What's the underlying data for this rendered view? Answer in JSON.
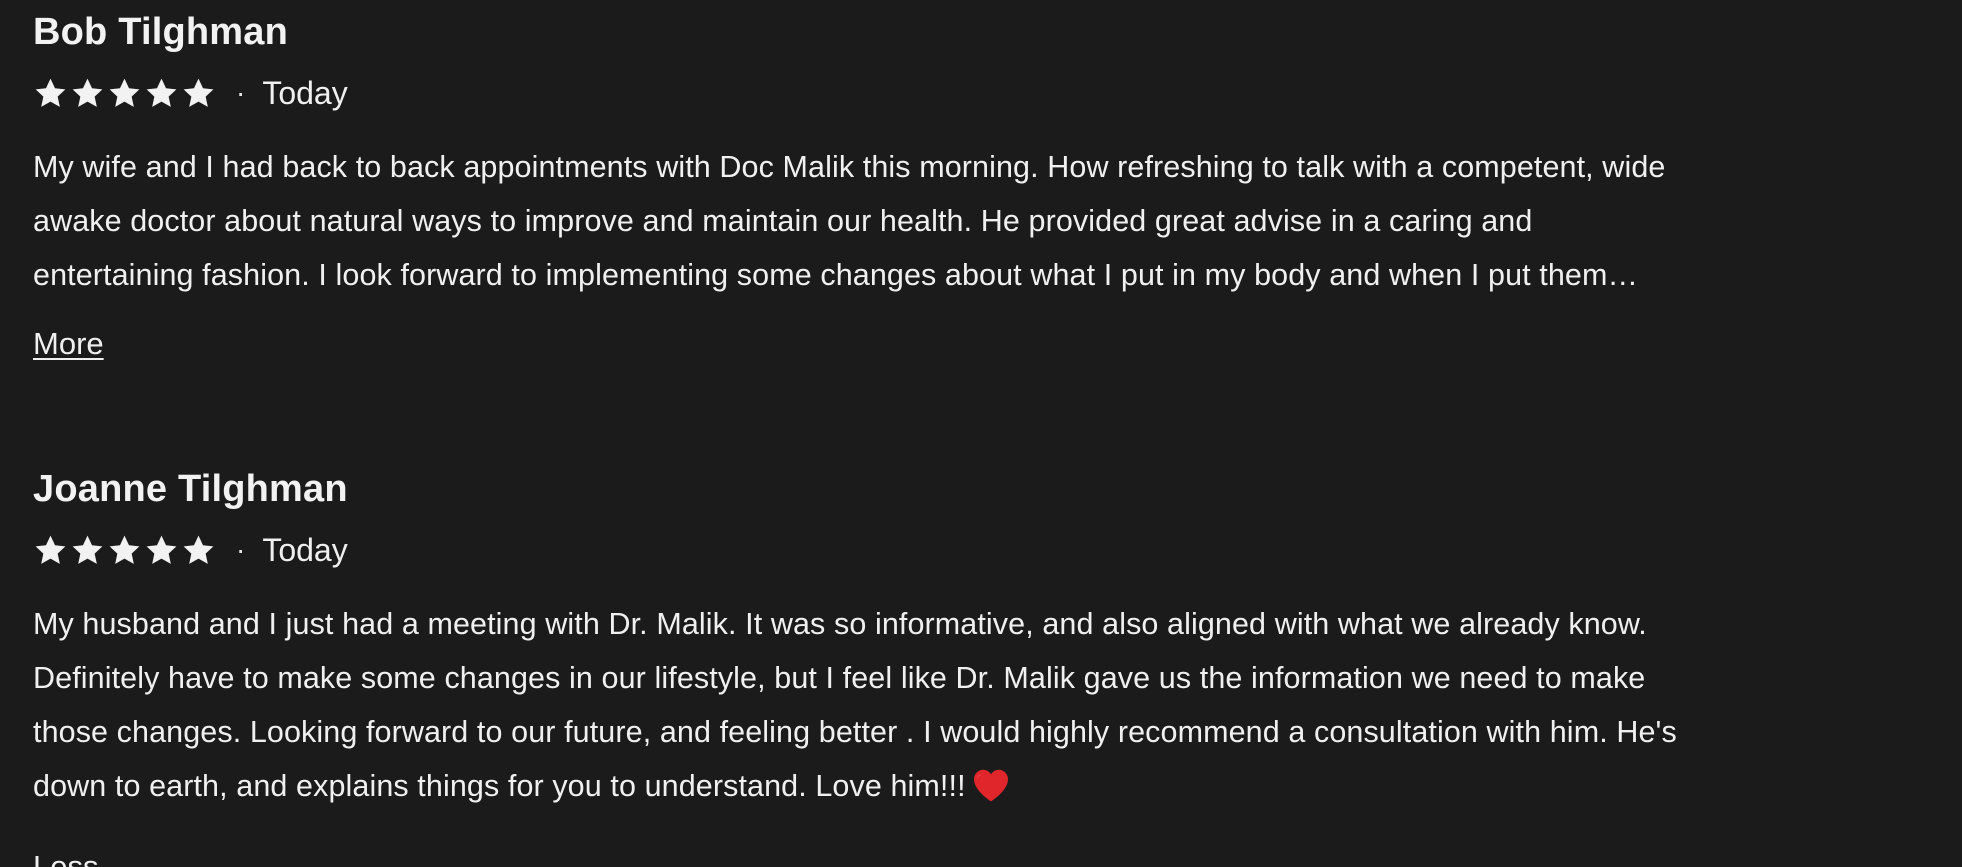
{
  "reviews": [
    {
      "name": "Bob Tilghman",
      "rating": 5,
      "separator": "·",
      "date": "Today",
      "text_lines": [
        "My wife and I had back to back appointments with Doc Malik this morning. How refreshing to talk with a competent, wide",
        "awake doctor about natural ways to improve and maintain our health. He provided great advise in a caring and",
        "entertaining fashion. I look forward to implementing some changes about what I put in my body and when I put them…"
      ],
      "toggle_label": "More"
    },
    {
      "name": "Joanne Tilghman",
      "rating": 5,
      "separator": "·",
      "date": "Today",
      "text_lines": [
        "My husband and I just had a meeting with Dr. Malik. It was so informative, and also aligned with what we already know.",
        "Definitely have to make some changes in our lifestyle, but I feel like Dr. Malik gave us the information we need to make",
        "those changes. Looking forward to our future, and feeling better . I would highly recommend a consultation with him. He's",
        "down to earth, and explains things for you to understand. Love him!!!"
      ],
      "emoji": "heart-icon",
      "toggle_label": "Less"
    }
  ],
  "colors": {
    "background": "#1b1b1c",
    "text": "#f0f0f0",
    "star": "#f2f2f2",
    "heart": "#e0262b"
  }
}
